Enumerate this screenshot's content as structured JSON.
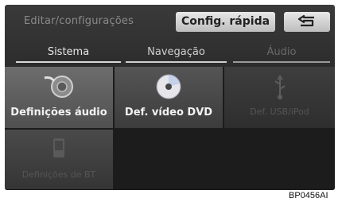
{
  "header": {
    "title": "Editar/configurações",
    "quick_config_label": "Config. rápida",
    "back_icon": "back-arrow-icon"
  },
  "tabs": [
    {
      "label": "Sistema",
      "state": "active"
    },
    {
      "label": "Navegação",
      "state": "normal"
    },
    {
      "label": "Áudio",
      "state": "disabled"
    }
  ],
  "grid": {
    "items": [
      {
        "label": "Definições áudio",
        "icon": "speaker-icon",
        "enabled": true
      },
      {
        "label": "Def. vídeo DVD",
        "icon": "disc-icon",
        "enabled": true
      },
      {
        "label": "Def. USB/iPod",
        "icon": "usb-icon",
        "enabled": false
      },
      {
        "label": "Definições de BT",
        "icon": "phone-icon",
        "enabled": false
      }
    ]
  },
  "figure_code": "BP0456AI"
}
